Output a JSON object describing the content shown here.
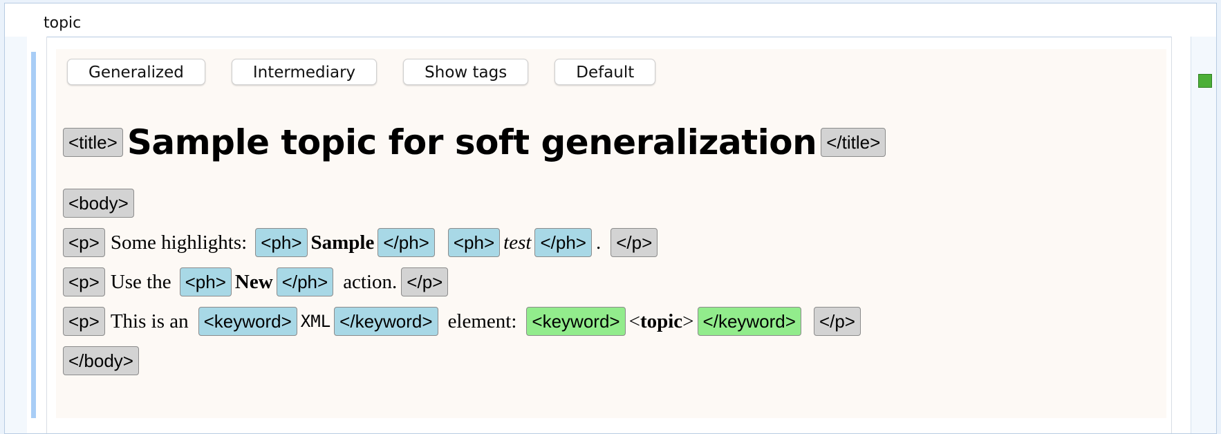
{
  "tab": {
    "label": "topic"
  },
  "toolbar": {
    "buttons": [
      "Generalized",
      "Intermediary",
      "Show tags",
      "Default"
    ]
  },
  "title": {
    "open_tag": "<title>",
    "text": "Sample topic for soft generalization",
    "close_tag": "</title>"
  },
  "body": {
    "open_tag": "<body>",
    "close_tag": "</body>"
  },
  "paragraphs": [
    {
      "open_tag": "<p>",
      "text1": "Some highlights:",
      "ph1_open": "<ph>",
      "ph1_text": "Sample",
      "ph1_close": "</ph>",
      "ph2_open": "<ph>",
      "ph2_text": "test",
      "ph2_close": "</ph>",
      "text2": ".",
      "close_tag": "</p>"
    },
    {
      "open_tag": "<p>",
      "text1": "Use the",
      "ph_open": "<ph>",
      "ph_text": "New",
      "ph_close": "</ph>",
      "text2": "action.",
      "close_tag": "</p>"
    },
    {
      "open_tag": "<p>",
      "text1": "This is an",
      "kw1_open": "<keyword>",
      "kw1_text": "XML",
      "kw1_close": "</keyword>",
      "text2": "element:",
      "kw2_open": "<keyword>",
      "kw2_text_lt": "<",
      "kw2_text": "topic",
      "kw2_text_gt": ">",
      "kw2_close": "</keyword>",
      "close_tag": "</p>"
    }
  ],
  "colors": {
    "content_bg": "#fdf9f5",
    "tag_gray": "#d3d3d3",
    "tag_blue": "#a8d8e6",
    "tag_green": "#92ec8c",
    "status_green": "#4caf37",
    "selection_bar": "#a8cdf6"
  }
}
